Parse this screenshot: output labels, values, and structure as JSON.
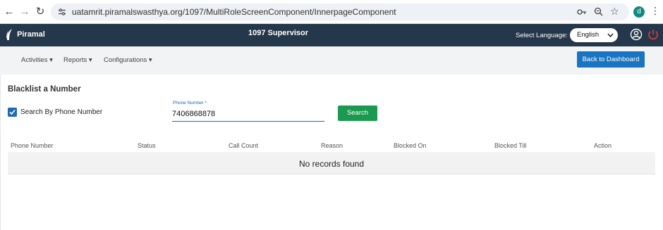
{
  "browser": {
    "url": "uatamrit.piramalswasthya.org/1097/MultiRoleScreenComponent/InnerpageComponent",
    "profile_initial": "d"
  },
  "header": {
    "brand": "Piramal",
    "title": "1097 Supervisor",
    "language_label": "Select Language:",
    "language_value": "English"
  },
  "menu": {
    "items": [
      "Activities ▾",
      "Reports ▾",
      "Configurations ▾"
    ],
    "back_button": "Back to Dashboard"
  },
  "main": {
    "title": "Blacklist a Number",
    "checkbox_label": "Search By Phone Number",
    "checkbox_checked": true,
    "phone_label": "Phone Number *",
    "phone_value": "7406868878",
    "search_button": "Search",
    "columns": [
      "Phone Number",
      "Status",
      "Call Count",
      "Reason",
      "Blocked On",
      "Blocked Till",
      "Action"
    ],
    "empty_message": "No records found"
  },
  "colors": {
    "header_bg": "#25374a",
    "primary": "#1974c1",
    "search_green": "#1b9a4f",
    "power_red": "#e53935"
  }
}
